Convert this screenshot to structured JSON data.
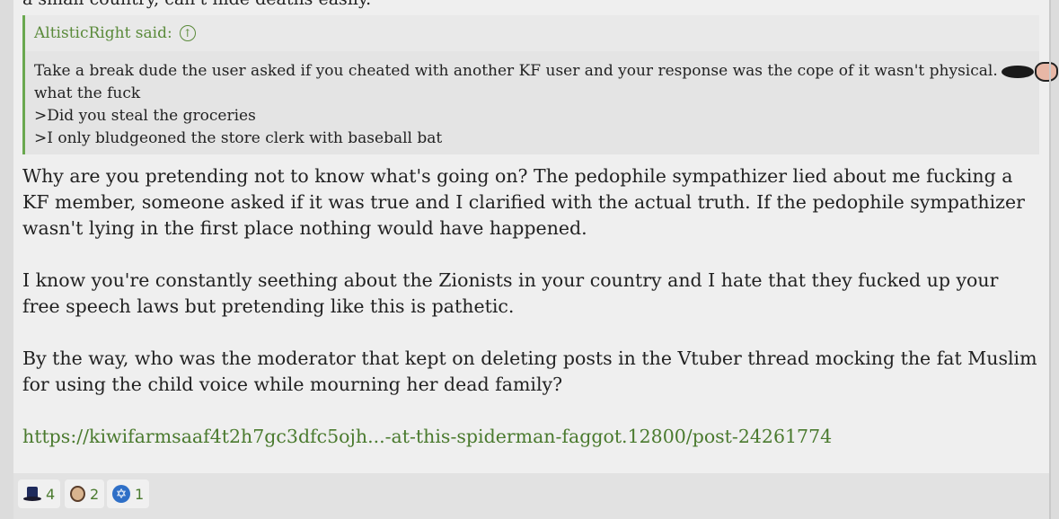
{
  "clipped_text": "a small country, can't hide deaths easily.",
  "quote": {
    "author": "AltisticRight said:",
    "lines": [
      "Take a break dude the user asked if you cheated with another KF user and your response was the cope of it wasn't physical.",
      "what the fuck",
      ">Did you steal the groceries",
      ">I only bludgeoned the store clerk with baseball bat"
    ]
  },
  "body": {
    "paragraphs": [
      "Why are you pretending not to know what's going on? The pedophile sympathizer lied about me fucking a KF member, someone asked if it was true and I clarified with the actual truth. If the pedophile sympathizer wasn't lying in the first place nothing would have happened.",
      "I know you're constantly seething about the Zionists in your country and I hate that they fucked up your free speech laws but pretending like this is pathetic.",
      "By the way, who was the moderator that kept on deleting posts in the Vtuber thread mocking the fat Muslim for using the child voice while mourning her dead family?"
    ],
    "link": "https://kiwifarmsaaf4t2h7gc3dfc5ojh...-at-this-spiderman-faggot.12800/post-24261774"
  },
  "reactions": [
    {
      "icon": "top-hat-icon",
      "count": "4"
    },
    {
      "icon": "face-icon",
      "count": "2"
    },
    {
      "icon": "star-of-david-icon",
      "count": "1"
    }
  ],
  "colors": {
    "accent": "#5a8a3a",
    "quote_border": "#6aa84f"
  }
}
